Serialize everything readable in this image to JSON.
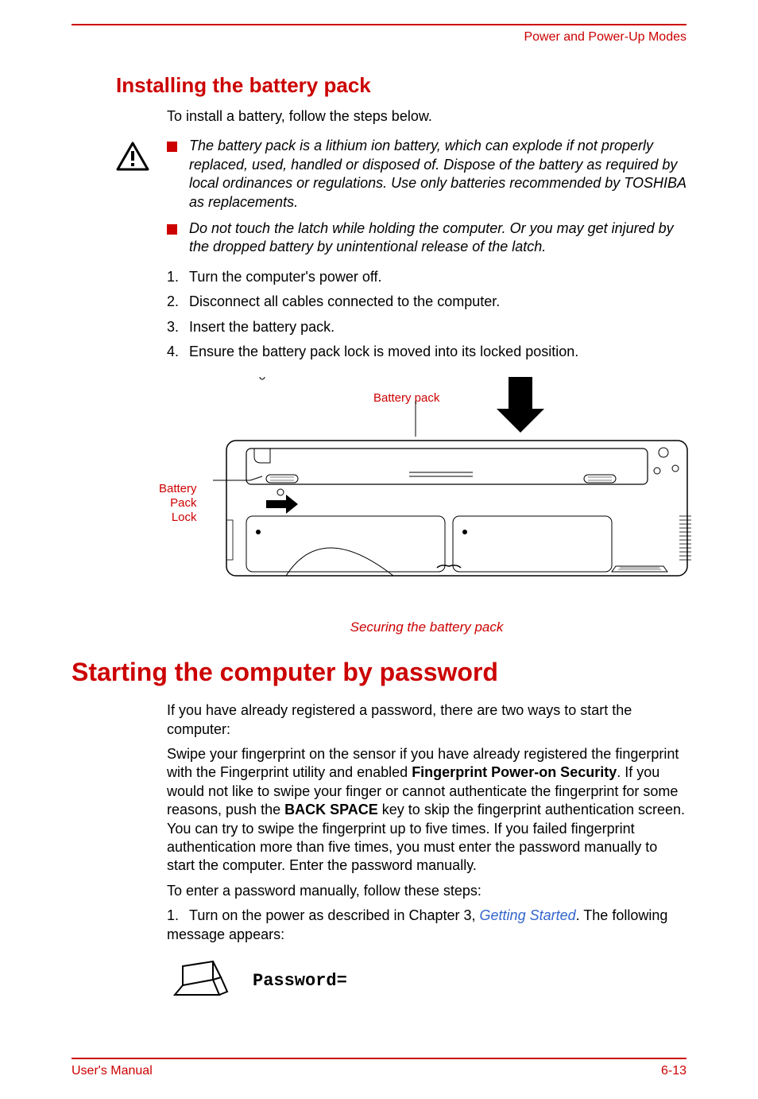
{
  "header": {
    "title": "Power and Power-Up Modes"
  },
  "section1": {
    "heading": "Installing the battery pack",
    "intro": "To install a battery, follow the steps below.",
    "warnings": [
      "The battery pack is a lithium ion battery, which can explode if not properly replaced, used, handled or disposed of. Dispose of the battery as required by local ordinances or regulations. Use only batteries recommended by TOSHIBA as replacements.",
      "Do not touch the latch while holding the computer. Or you may get injured by the dropped battery by unintentional release of the latch."
    ],
    "steps": [
      "Turn the computer's power off.",
      "Disconnect all cables connected to the computer.",
      "Insert the battery pack.",
      "Ensure the battery pack lock is moved into its locked position."
    ],
    "figure": {
      "label_top": "Battery pack",
      "label_left": "Battery\nPack\nLock",
      "caption": "Securing the battery pack"
    }
  },
  "section2": {
    "heading": "Starting the computer by password",
    "para1": "If you have already registered a password, there are two ways to start the computer:",
    "para2_pre": "Swipe your fingerprint on the sensor if you have already registered the fingerprint with the Fingerprint utility and enabled ",
    "para2_bold1": "Fingerprint Power-on Security",
    "para2_mid": ". If you would not like to swipe your finger or cannot authenticate the fingerprint for some reasons, push the ",
    "para2_bold2": "BACK SPACE",
    "para2_post": " key to skip the fingerprint authentication screen. You can try to swipe the fingerprint up to five times. If you failed fingerprint authentication more than five times, you must enter the password manually to start the computer. Enter the password manually.",
    "para3": "To enter a password manually, follow these steps:",
    "step1_pre": "Turn on the power as described in Chapter 3, ",
    "step1_link": "Getting Started",
    "step1_post": ". The following message appears:",
    "password_prompt": "Password="
  },
  "footer": {
    "left": "User's Manual",
    "right": "6-13"
  }
}
